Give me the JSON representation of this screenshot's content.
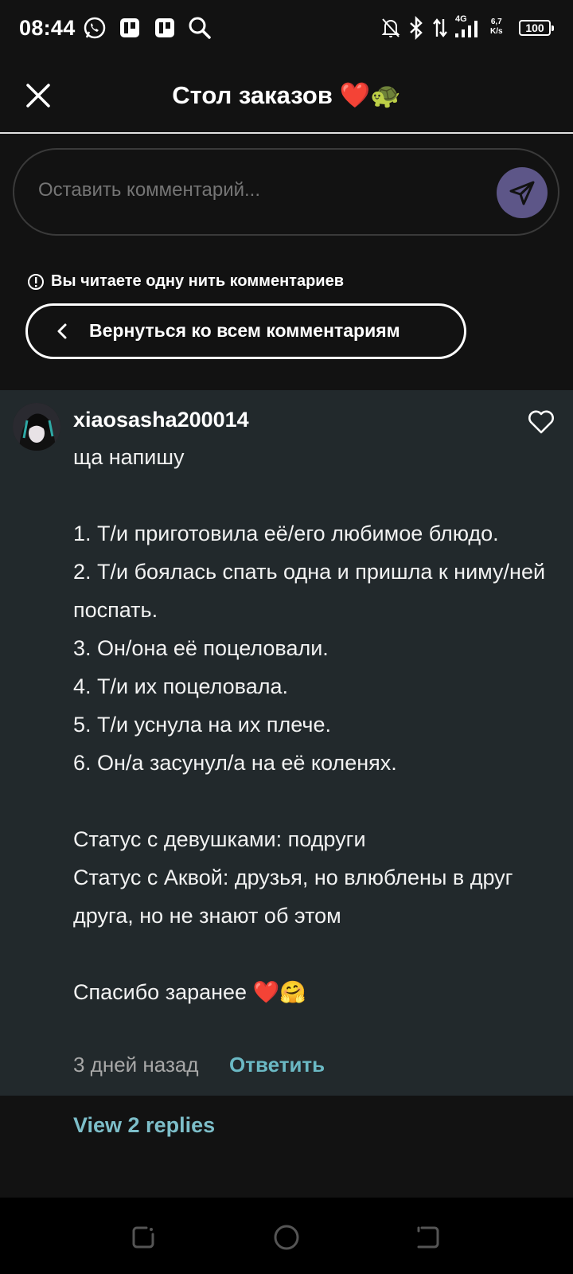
{
  "status_bar": {
    "time": "08:44",
    "network": "4G",
    "speed_value": "6,7",
    "speed_unit": "K/s",
    "battery": "100",
    "icons": [
      "whatsapp-icon",
      "p-app-icon",
      "p-app-icon",
      "search-icon",
      "mute-icon",
      "bluetooth-icon",
      "data-arrows-icon",
      "signal-icon"
    ]
  },
  "header": {
    "title": "Стол заказов ❤️🐢",
    "close_icon": "close-icon"
  },
  "comment_input": {
    "placeholder": "Оставить комментарий...",
    "send_icon": "send-icon"
  },
  "thread_notice": {
    "text": "Вы читаете одну нить комментариев",
    "back_label": "Вернуться ко всем комментариям"
  },
  "comment": {
    "username": "xiaosasha200014",
    "body": "ща напишу\n\n1. Т/и приготовила её/его любимое блюдо.\n2. Т/и боялась спать одна и пришла к ниму/ней поспать.\n3. Он/она её поцеловали.\n4. Т/и их поцеловала.\n5. Т/и уснула на их плече.\n6. Он/а засунул/а на её коленях.\n\nСтатус с девушками: подруги\nСтатус с Аквой: друзья, но влюблены в друг друга, но не знают об этом\n\nСпасибо заранее ❤️🤗",
    "time_ago": "3 дней назад",
    "reply_label": "Ответить",
    "view_replies": "View 2 replies"
  },
  "colors": {
    "background": "#121212",
    "card": "#22292c",
    "accent": "#6bb9c4",
    "send_button": "#5d5688"
  }
}
